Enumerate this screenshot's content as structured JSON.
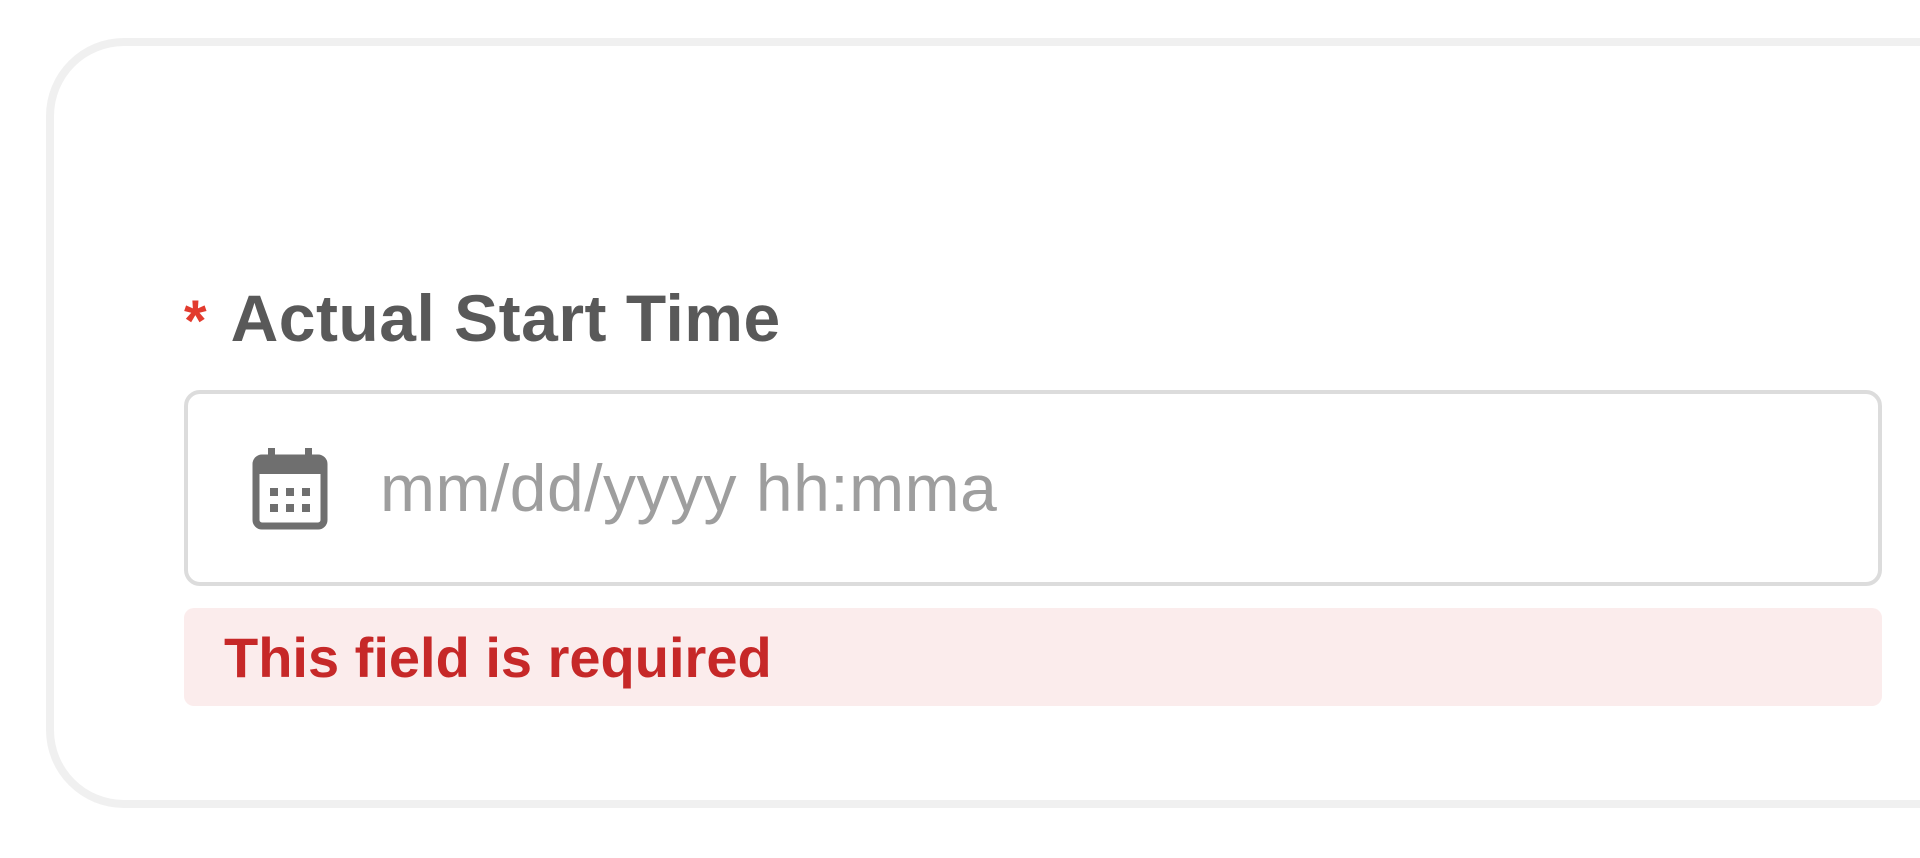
{
  "field": {
    "required_marker": "*",
    "label": "Actual Start Time",
    "placeholder": "mm/dd/yyyy hh:mma",
    "value": "",
    "icon": "calendar-icon",
    "error_message": "This field is required"
  },
  "colors": {
    "required_marker": "#e23b2e",
    "label_text": "#595959",
    "placeholder_text": "#9e9e9e",
    "input_border": "#dcdcdc",
    "error_background": "#fbecec",
    "error_text": "#c62828",
    "card_border": "#f0f0f0"
  }
}
